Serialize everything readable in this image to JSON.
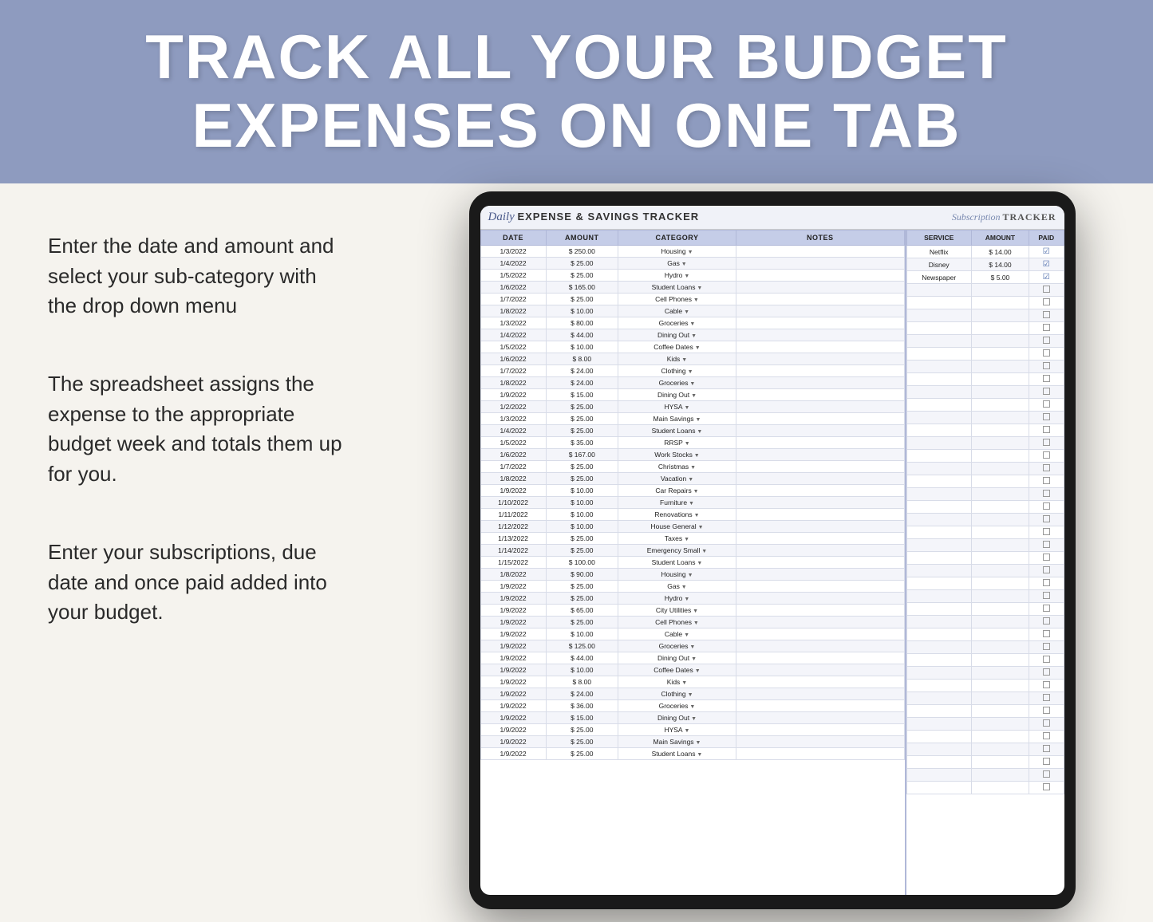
{
  "banner": {
    "line1": "TRACK ALL YOUR BUDGET",
    "line2": "EXPENSES ON ONE TAB"
  },
  "left_panel": {
    "text1": "Enter the date and amount and select your sub-category with the drop down menu",
    "text2": "The spreadsheet assigns the expense to the appropriate budget week and totals them up for you.",
    "text3": "Enter your subscriptions, due date and once paid added into your budget."
  },
  "sheet": {
    "title_italic": "Daily",
    "title_bold": "EXPENSE & SAVINGS TRACKER",
    "sub_italic": "Subscription",
    "sub_bold": "TRACKER"
  },
  "expense_table": {
    "headers": [
      "DATE",
      "AMOUNT",
      "CATEGORY",
      "NOTES"
    ],
    "rows": [
      [
        "1/3/2022",
        "$ 250.00",
        "Housing",
        ""
      ],
      [
        "1/4/2022",
        "$ 25.00",
        "Gas",
        ""
      ],
      [
        "1/5/2022",
        "$ 25.00",
        "Hydro",
        ""
      ],
      [
        "1/6/2022",
        "$ 165.00",
        "Student Loans",
        ""
      ],
      [
        "1/7/2022",
        "$ 25.00",
        "Cell Phones",
        ""
      ],
      [
        "1/8/2022",
        "$ 10.00",
        "Cable",
        ""
      ],
      [
        "1/3/2022",
        "$ 80.00",
        "Groceries",
        ""
      ],
      [
        "1/4/2022",
        "$ 44.00",
        "Dining Out",
        ""
      ],
      [
        "1/5/2022",
        "$ 10.00",
        "Coffee Dates",
        ""
      ],
      [
        "1/6/2022",
        "$ 8.00",
        "Kids",
        ""
      ],
      [
        "1/7/2022",
        "$ 24.00",
        "Clothing",
        ""
      ],
      [
        "1/8/2022",
        "$ 24.00",
        "Groceries",
        ""
      ],
      [
        "1/9/2022",
        "$ 15.00",
        "Dining Out",
        ""
      ],
      [
        "1/2/2022",
        "$ 25.00",
        "HYSA",
        ""
      ],
      [
        "1/3/2022",
        "$ 25.00",
        "Main Savings",
        ""
      ],
      [
        "1/4/2022",
        "$ 25.00",
        "Student Loans",
        ""
      ],
      [
        "1/5/2022",
        "$ 35.00",
        "RRSP",
        ""
      ],
      [
        "1/6/2022",
        "$ 167.00",
        "Work Stocks",
        ""
      ],
      [
        "1/7/2022",
        "$ 25.00",
        "Christmas",
        ""
      ],
      [
        "1/8/2022",
        "$ 25.00",
        "Vacation",
        ""
      ],
      [
        "1/9/2022",
        "$ 10.00",
        "Car Repairs",
        ""
      ],
      [
        "1/10/2022",
        "$ 10.00",
        "Furniture",
        ""
      ],
      [
        "1/11/2022",
        "$ 10.00",
        "Renovations",
        ""
      ],
      [
        "1/12/2022",
        "$ 10.00",
        "House General",
        ""
      ],
      [
        "1/13/2022",
        "$ 25.00",
        "Taxes",
        ""
      ],
      [
        "1/14/2022",
        "$ 25.00",
        "Emergency Small",
        ""
      ],
      [
        "1/15/2022",
        "$ 100.00",
        "Student Loans",
        ""
      ],
      [
        "1/8/2022",
        "$ 90.00",
        "Housing",
        ""
      ],
      [
        "1/9/2022",
        "$ 25.00",
        "Gas",
        ""
      ],
      [
        "1/9/2022",
        "$ 25.00",
        "Hydro",
        ""
      ],
      [
        "1/9/2022",
        "$ 65.00",
        "City Utilities",
        ""
      ],
      [
        "1/9/2022",
        "$ 25.00",
        "Cell Phones",
        ""
      ],
      [
        "1/9/2022",
        "$ 10.00",
        "Cable",
        ""
      ],
      [
        "1/9/2022",
        "$ 125.00",
        "Groceries",
        ""
      ],
      [
        "1/9/2022",
        "$ 44.00",
        "Dining Out",
        ""
      ],
      [
        "1/9/2022",
        "$ 10.00",
        "Coffee Dates",
        ""
      ],
      [
        "1/9/2022",
        "$ 8.00",
        "Kids",
        ""
      ],
      [
        "1/9/2022",
        "$ 24.00",
        "Clothing",
        ""
      ],
      [
        "1/9/2022",
        "$ 36.00",
        "Groceries",
        ""
      ],
      [
        "1/9/2022",
        "$ 15.00",
        "Dining Out",
        ""
      ],
      [
        "1/9/2022",
        "$ 25.00",
        "HYSA",
        ""
      ],
      [
        "1/9/2022",
        "$ 25.00",
        "Main Savings",
        ""
      ],
      [
        "1/9/2022",
        "$ 25.00",
        "Student Loans",
        ""
      ]
    ]
  },
  "subscription_table": {
    "headers": [
      "SERVICE",
      "AMOUNT",
      "PAID"
    ],
    "rows": [
      [
        "Netflix",
        "$ 14.00",
        "✓"
      ],
      [
        "Disney",
        "$ 14.00",
        "✓"
      ],
      [
        "Newspaper",
        "$ 5.00",
        "✓"
      ],
      [
        "",
        "",
        ""
      ],
      [
        "",
        "",
        ""
      ],
      [
        "",
        "",
        ""
      ],
      [
        "",
        "",
        ""
      ],
      [
        "",
        "",
        ""
      ],
      [
        "",
        "",
        ""
      ],
      [
        "",
        "",
        ""
      ],
      [
        "",
        "",
        ""
      ],
      [
        "",
        "",
        ""
      ],
      [
        "",
        "",
        ""
      ],
      [
        "",
        "",
        ""
      ],
      [
        "",
        "",
        ""
      ],
      [
        "",
        "",
        ""
      ],
      [
        "",
        "",
        ""
      ],
      [
        "",
        "",
        ""
      ],
      [
        "",
        "",
        ""
      ],
      [
        "",
        "",
        ""
      ],
      [
        "",
        "",
        ""
      ],
      [
        "",
        "",
        ""
      ],
      [
        "",
        "",
        ""
      ],
      [
        "",
        "",
        ""
      ],
      [
        "",
        "",
        ""
      ],
      [
        "",
        "",
        ""
      ],
      [
        "",
        "",
        ""
      ],
      [
        "",
        "",
        ""
      ],
      [
        "",
        "",
        ""
      ],
      [
        "",
        "",
        ""
      ],
      [
        "",
        "",
        ""
      ],
      [
        "",
        "",
        ""
      ],
      [
        "",
        "",
        ""
      ],
      [
        "",
        "",
        ""
      ],
      [
        "",
        "",
        ""
      ],
      [
        "",
        "",
        ""
      ],
      [
        "",
        "",
        ""
      ],
      [
        "",
        "",
        ""
      ],
      [
        "",
        "",
        ""
      ],
      [
        "",
        "",
        ""
      ],
      [
        "",
        "",
        ""
      ],
      [
        "",
        "",
        ""
      ],
      [
        "",
        "",
        ""
      ]
    ]
  }
}
